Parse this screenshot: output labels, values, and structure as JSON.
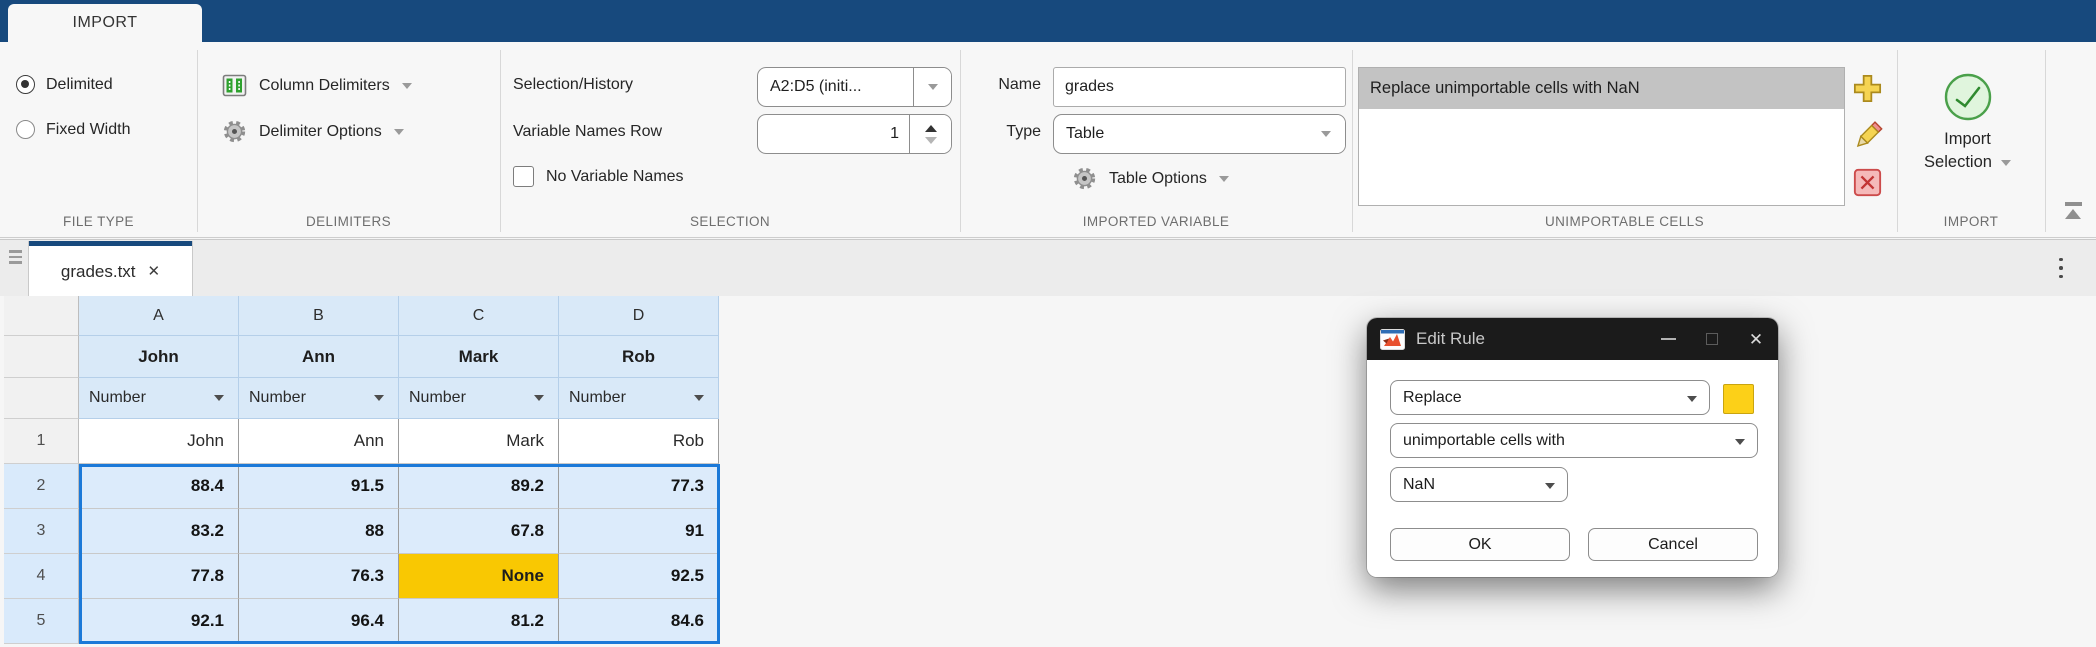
{
  "ribbon": {
    "tab_label": "IMPORT",
    "file_type": {
      "option_delimited": "Delimited",
      "option_fixed_width": "Fixed Width",
      "selected": "Delimited"
    },
    "delimiters": {
      "column_delimiters_label": "Column Delimiters",
      "delimiter_options_label": "Delimiter Options"
    },
    "selection": {
      "history_label": "Selection/History",
      "history_value": "A2:D5 (initi...",
      "variable_names_row_label": "Variable Names Row",
      "variable_names_row_value": "1",
      "no_variable_names_label": "No Variable Names"
    },
    "imported_variable": {
      "name_label": "Name",
      "name_value": "grades",
      "type_label": "Type",
      "type_value": "Table",
      "table_options_label": "Table Options"
    },
    "unimportable_cells": {
      "selected_rule": "Replace unimportable cells with NaN"
    },
    "import": {
      "button_line1": "Import",
      "button_line2": "Selection"
    },
    "section_labels": [
      "FILE TYPE",
      "DELIMITERS",
      "SELECTION",
      "IMPORTED VARIABLE",
      "UNIMPORTABLE CELLS",
      "IMPORT"
    ]
  },
  "tabstrip": {
    "doc_tab_title": "grades.txt",
    "close_glyph": "✕"
  },
  "grid": {
    "type_selector_value": "Number",
    "columns": [
      {
        "letter": "A",
        "name": "John"
      },
      {
        "letter": "B",
        "name": "Ann"
      },
      {
        "letter": "C",
        "name": "Mark"
      },
      {
        "letter": "D",
        "name": "Rob"
      }
    ],
    "rows": [
      {
        "num": "1",
        "cells": [
          "John",
          "Ann",
          "Mark",
          "Rob"
        ]
      },
      {
        "num": "2",
        "cells": [
          "88.4",
          "91.5",
          "89.2",
          "77.3"
        ]
      },
      {
        "num": "3",
        "cells": [
          "83.2",
          "88",
          "67.8",
          "91"
        ]
      },
      {
        "num": "4",
        "cells": [
          "77.8",
          "76.3",
          "None",
          "92.5"
        ]
      },
      {
        "num": "5",
        "cells": [
          "92.1",
          "96.4",
          "81.2",
          "84.6"
        ]
      }
    ],
    "highlighted_cell": {
      "row": "4",
      "column": "C",
      "value": "None"
    },
    "selection_range": "A2:D5"
  },
  "dialog": {
    "title": "Edit Rule",
    "dropdown_action": "Replace",
    "dropdown_target": "unimportable cells with",
    "dropdown_value": "NaN",
    "ok_label": "OK",
    "cancel_label": "Cancel"
  },
  "colors": {
    "ribbon_blue": "#17497d",
    "selection_border_blue": "#1b79d8",
    "selected_cell_blue": "#dcebfb",
    "header_blue": "#d9e9f8",
    "highlight_yellow": "#f9c802",
    "swatch_yellow": "#fcd018",
    "rule_selected_gray": "#c3c3c3",
    "import_green": "#3f9c3f",
    "dialog_titlebar": "#1b1b1b"
  }
}
